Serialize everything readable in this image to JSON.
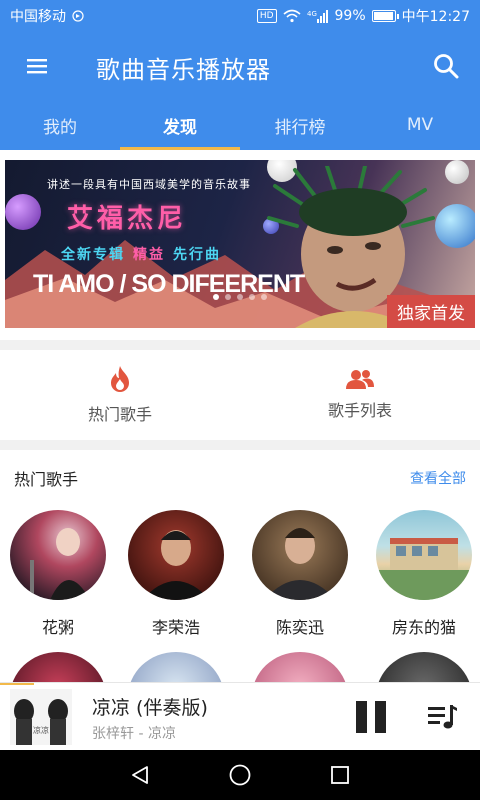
{
  "status_bar": {
    "carrier": "中国移动",
    "hd": "HD",
    "network": "4G",
    "battery": "99%",
    "battery_level": 0.99,
    "time": "中午12:27"
  },
  "app_bar": {
    "title": "歌曲音乐播放器"
  },
  "tabs": [
    {
      "label": "我的",
      "active": false
    },
    {
      "label": "发现",
      "active": true
    },
    {
      "label": "排行榜",
      "active": false
    },
    {
      "label": "MV",
      "active": false
    }
  ],
  "banner": {
    "tagline": "讲述一段具有中国西域美学的音乐故事",
    "artist": "艾福杰尼",
    "album_prefix": "全新专辑",
    "album_name": "精益",
    "album_suffix": "先行曲",
    "song": "TI AMO / SO DIFEERENT",
    "badge": "独家首发"
  },
  "quick_links": [
    {
      "label": "热门歌手",
      "icon": "flame-icon",
      "color": "#e2563f"
    },
    {
      "label": "歌手列表",
      "icon": "people-icon",
      "color": "#e2563f"
    }
  ],
  "hot_singers": {
    "title": "热门歌手",
    "view_all": "查看全部",
    "singers": [
      {
        "name": "花粥"
      },
      {
        "name": "李荣浩"
      },
      {
        "name": "陈奕迅"
      },
      {
        "name": "房东的猫"
      }
    ]
  },
  "player": {
    "title": "凉凉 (伴奏版)",
    "subtitle": "张梓轩 - 凉凉",
    "cover_text": "凉凉",
    "progress": 0.07
  },
  "nav": {
    "back": "back-icon",
    "home": "home-icon",
    "recents": "recents-icon"
  },
  "colors": {
    "primary": "#3f8ceb",
    "accent": "#f2b94a",
    "link": "#3f8ceb",
    "badge": "#d44b45"
  }
}
